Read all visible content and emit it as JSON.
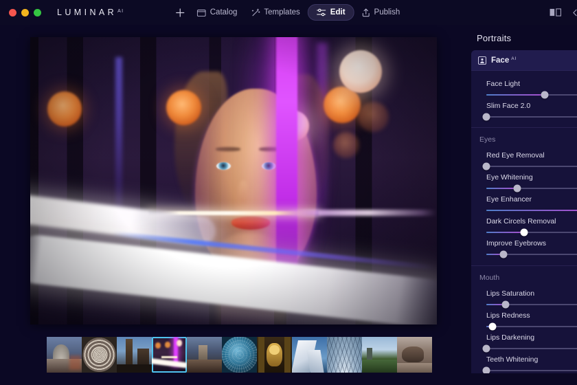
{
  "window": {
    "app_name": "LUMINAR",
    "app_suffix": "AI",
    "traffic_lights": [
      "close",
      "minimize",
      "zoom"
    ]
  },
  "topbar": {
    "add_label": "+",
    "items": [
      {
        "label": "Catalog",
        "icon": "folder-icon",
        "active": false
      },
      {
        "label": "Templates",
        "icon": "wand-sparkle-icon",
        "active": false
      },
      {
        "label": "Edit",
        "icon": "sliders-icon",
        "active": true
      },
      {
        "label": "Publish",
        "icon": "share-upload-icon",
        "active": false
      }
    ],
    "right_icons": [
      "compare-split-icon",
      "panel-toggle-icon"
    ]
  },
  "panel": {
    "title": "Portraits",
    "tool": {
      "name": "Face",
      "superscript": "AI",
      "icon": "portrait-frame-icon"
    },
    "groups": [
      {
        "label": "",
        "sliders": [
          {
            "name": "Face Light",
            "value": 58,
            "knob": "normal"
          },
          {
            "name": "Slim Face 2.0",
            "value": 0,
            "knob": "normal"
          }
        ]
      },
      {
        "label": "Eyes",
        "sliders": [
          {
            "name": "Red Eye Removal",
            "value": 0,
            "knob": "normal"
          },
          {
            "name": "Eye Whitening",
            "value": 31,
            "knob": "normal"
          },
          {
            "name": "Eye Enhancer",
            "value": 98,
            "knob": "normal"
          },
          {
            "name": "Dark Circels Removal",
            "value": 38,
            "knob": "bright"
          },
          {
            "name": "Improve Eyebrows",
            "value": 17,
            "knob": "normal"
          }
        ]
      },
      {
        "label": "Mouth",
        "sliders": [
          {
            "name": "Lips Saturation",
            "value": 19,
            "knob": "normal"
          },
          {
            "name": "Lips Redness",
            "value": 6,
            "knob": "bright"
          },
          {
            "name": "Lips Darkening",
            "value": 0,
            "knob": "normal"
          },
          {
            "name": "Teeth Whitening",
            "value": 0,
            "knob": "normal"
          }
        ]
      }
    ]
  },
  "filmstrip": {
    "selected_index": 3,
    "thumbnails": [
      {
        "name": "cathedral-dome-building"
      },
      {
        "name": "circular-ceiling-architecture"
      },
      {
        "name": "totem-pole-blue-sky"
      },
      {
        "name": "woman-neon-reflection-portrait"
      },
      {
        "name": "stone-tower-dusk"
      },
      {
        "name": "geodesic-sphere-blue"
      },
      {
        "name": "golden-buddha-statue"
      },
      {
        "name": "white-sail-structure"
      },
      {
        "name": "glass-dome-lattice"
      },
      {
        "name": "green-field-church"
      },
      {
        "name": "desert-rock-landscape"
      }
    ]
  },
  "colors": {
    "app_background": "#0b0824",
    "panel_card": "#16123a",
    "tool_header": "#211c4e",
    "accent_selection": "#4fc4ef",
    "slider_fill_start": "#4e7fc9",
    "slider_fill_end": "#a84fd0",
    "text_primary": "#e9e8f4",
    "text_muted": "#8c88a8"
  }
}
